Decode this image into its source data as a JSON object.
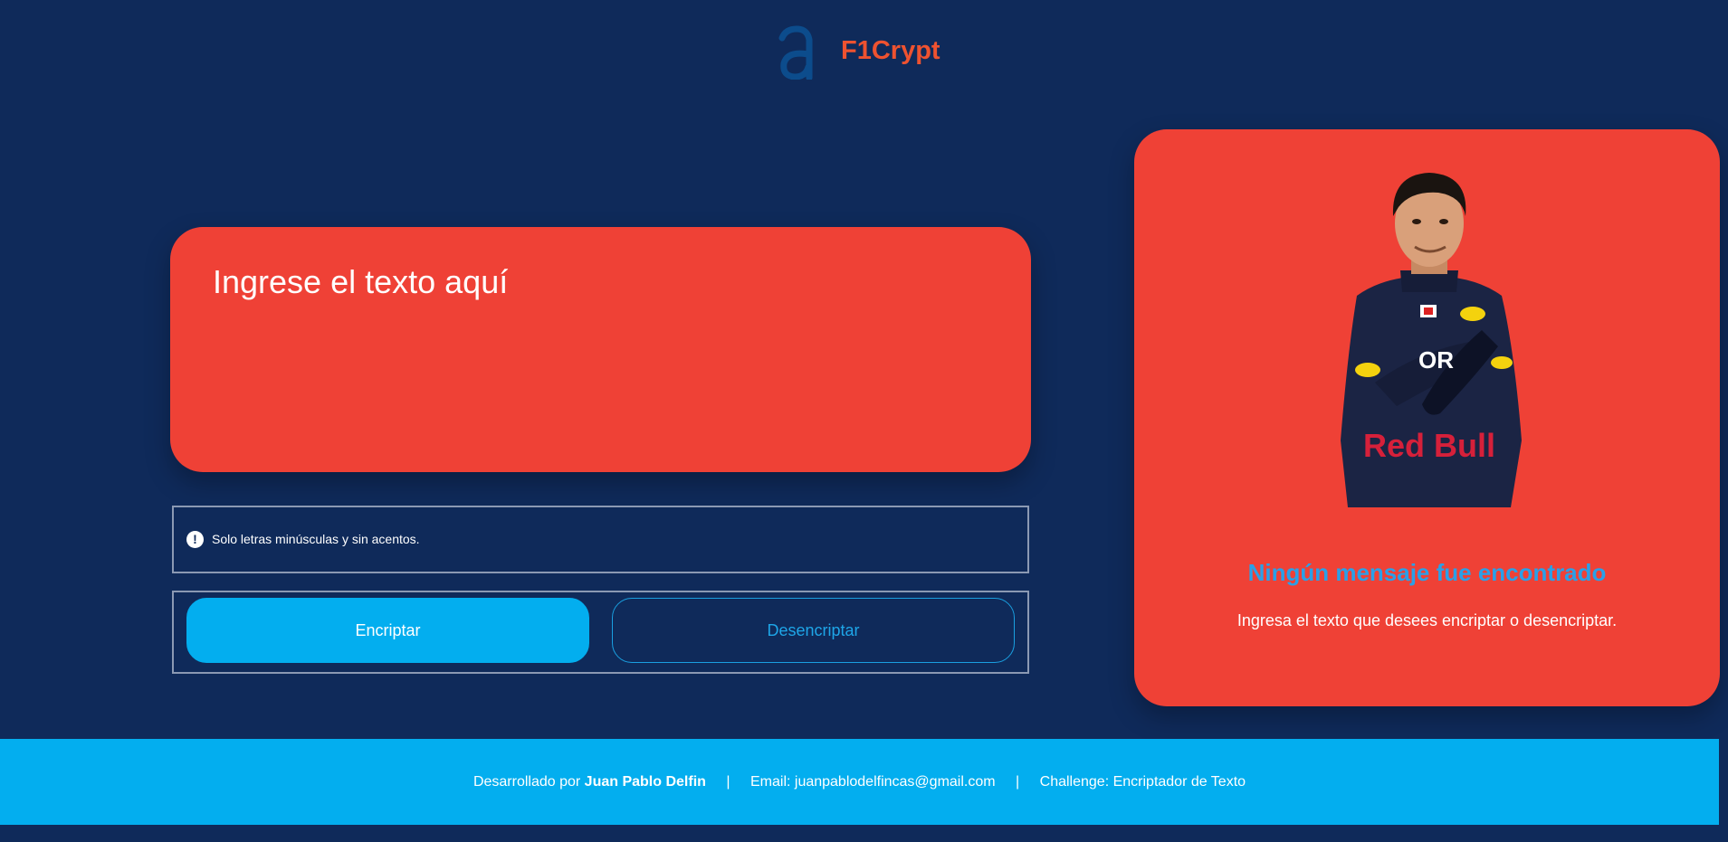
{
  "header": {
    "logo_letter": "a",
    "brand": "F1Crypt"
  },
  "input": {
    "placeholder": "Ingrese el texto aquí"
  },
  "hint": {
    "icon": "exclamation-icon",
    "text": "Solo letras minúsculas y sin acentos."
  },
  "buttons": {
    "encrypt_label": "Encriptar",
    "decrypt_label": "Desencriptar"
  },
  "output": {
    "image": "f1-driver-illustration",
    "image_text": "Red Bull",
    "title": "Ningún mensaje fue encontrado",
    "subtitle": "Ingresa el texto que desees encriptar o desencriptar."
  },
  "footer": {
    "developed_prefix": "Desarrollado por",
    "developer_name": "Juan Pablo Delfin",
    "separator": "|",
    "email": "Email: juanpablodelfincas@gmail.com",
    "challenge": "Challenge: Encriptador de Texto"
  },
  "colors": {
    "background": "#0f2a5a",
    "card": "#ef4136",
    "brand": "#ee5230",
    "accent_blue": "#03aeef",
    "title_blue": "#2aa0e8"
  }
}
